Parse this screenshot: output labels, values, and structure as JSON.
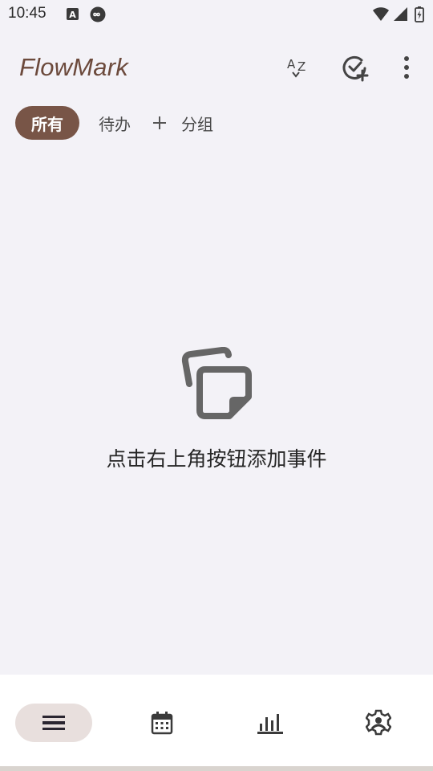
{
  "status_bar": {
    "time": "10:45",
    "icons": [
      "a-icon",
      "infinity-icon",
      "wifi-icon",
      "signal-icon",
      "battery-icon"
    ]
  },
  "app_bar": {
    "title": "FlowMark",
    "actions": [
      "sort-az-icon",
      "add-check-icon",
      "more-vert-icon"
    ]
  },
  "tabs": {
    "items": [
      {
        "label": "所有",
        "selected": true
      },
      {
        "label": "待办",
        "selected": false
      }
    ],
    "add_group_label": "分组"
  },
  "empty_state": {
    "icon": "notes-copy-icon",
    "message": "点击右上角按钮添加事件"
  },
  "bottom_nav": {
    "items": [
      {
        "icon": "list-icon",
        "active": true
      },
      {
        "icon": "calendar-icon",
        "active": false
      },
      {
        "icon": "bar-chart-icon",
        "active": false
      },
      {
        "icon": "settings-icon",
        "active": false
      }
    ]
  },
  "colors": {
    "accent": "#785547",
    "title": "#6c4a3c",
    "background": "#f3f2f7",
    "nav_active_pill": "#e8dfdd"
  }
}
